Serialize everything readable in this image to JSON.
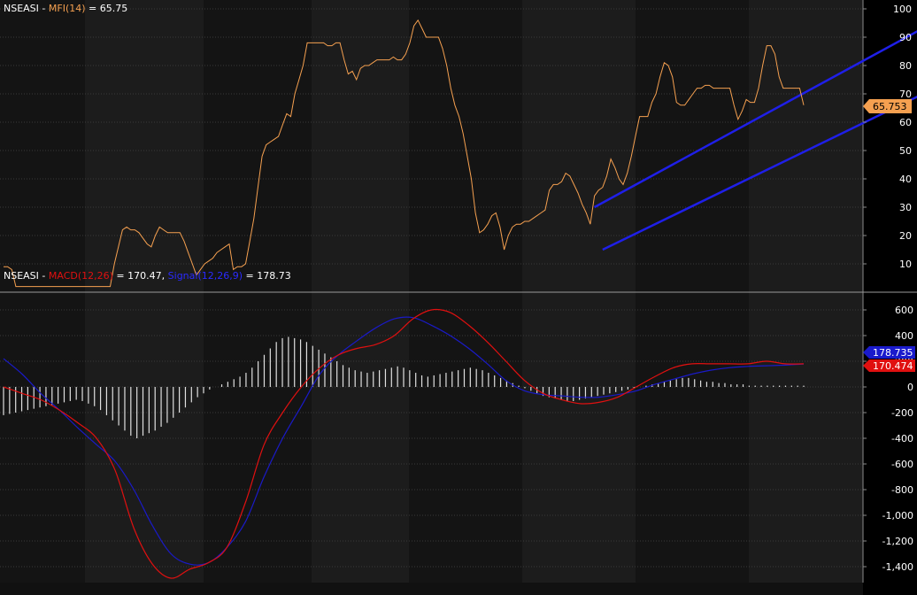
{
  "colors": {
    "background": "#000000",
    "band_dark": "#141414",
    "band_light": "#1c1c1c",
    "grid": "#3a3a3a",
    "divider": "#9a9a9a",
    "mfi": "#f5a050",
    "mfi_badge": "#f5a050",
    "channel": "#1f1fe8",
    "macd": "#e01010",
    "signal": "#1a1ac8",
    "histogram": "#e0e0e0",
    "text": "#ffffff"
  },
  "header_top": {
    "symbol": "NSEASI",
    "sep": " - ",
    "indicator": "MFI(14)",
    "eq": " = ",
    "value": "65.75"
  },
  "header_bottom": {
    "symbol": "NSEASI",
    "sep": " - ",
    "macd_name": "MACD(12,26)",
    "eq1": " = ",
    "macd_value": "170.47",
    "comma": ", ",
    "signal_name": "Signal(12,26,9)",
    "eq2": " = ",
    "signal_value": "178.73"
  },
  "badges": {
    "mfi_last": "65.753",
    "signal_last": "178.735",
    "macd_last": "170.474"
  },
  "chart_data": [
    {
      "type": "line",
      "title": "NSEASI - MFI(14) = 65.75",
      "ylim": [
        0,
        100
      ],
      "yticks": [
        "10",
        "20",
        "30",
        "40",
        "50",
        "60",
        "70",
        "80",
        "90",
        "100"
      ],
      "series": [
        {
          "name": "MFI(14)",
          "values": [
            9,
            9,
            8,
            2,
            2,
            2,
            2,
            2,
            2,
            2,
            2,
            2,
            2,
            2,
            2,
            2,
            2,
            2,
            2,
            2,
            2,
            2,
            2,
            2,
            2,
            2,
            2,
            10,
            16,
            22,
            23,
            22,
            22,
            21,
            19,
            17,
            16,
            20,
            23,
            22,
            21,
            21,
            21,
            21,
            18,
            14,
            10,
            6,
            8,
            10,
            11,
            12,
            14,
            15,
            16,
            17,
            8,
            9,
            9,
            10,
            18,
            26,
            37,
            48,
            52,
            53,
            54,
            55,
            59,
            63,
            62,
            70,
            75,
            80,
            88,
            88,
            88,
            88,
            88,
            87,
            87,
            88,
            88,
            82,
            77,
            78,
            75,
            79,
            80,
            80,
            81,
            82,
            82,
            82,
            82,
            83,
            82,
            82,
            84,
            88,
            94,
            96,
            93,
            90,
            90,
            90,
            90,
            86,
            80,
            72,
            66,
            62,
            56,
            48,
            40,
            28,
            21,
            22,
            24,
            27,
            28,
            23,
            15,
            20,
            23,
            24,
            24,
            25,
            25,
            26,
            27,
            28,
            29,
            36,
            38,
            38,
            39,
            42,
            41,
            38,
            35,
            31,
            28,
            24,
            34,
            36,
            37,
            41,
            47,
            44,
            40,
            38,
            42,
            48,
            55,
            62,
            62,
            62,
            67,
            70,
            76,
            81,
            80,
            76,
            67,
            66,
            66,
            68,
            70,
            72,
            72,
            73,
            73,
            72,
            72,
            72,
            72,
            72,
            66,
            61,
            64,
            68,
            67,
            67,
            72,
            80,
            87,
            87,
            84,
            76,
            72,
            72,
            72,
            72,
            72,
            66
          ]
        }
      ],
      "channel_lines": [
        {
          "name": "upper",
          "x": [
            144,
            234
          ],
          "y": [
            30,
            101
          ]
        },
        {
          "name": "lower",
          "x": [
            146,
            244
          ],
          "y": [
            15,
            84
          ]
        }
      ]
    },
    {
      "type": "line",
      "title": "NSEASI - MACD(12,26) = 170.47, Signal(12,26,9) = 178.73",
      "ylim": [
        -1520,
        770
      ],
      "yticks": [
        "600",
        "400",
        "200",
        "0",
        "-200",
        "-400",
        "-600",
        "-800",
        "-1,000",
        "-1,200",
        "-1,400"
      ],
      "series": [
        {
          "name": "MACD(12,26)",
          "values": [
            0,
            -50,
            -100,
            -180,
            -280,
            -400,
            -650,
            -1100,
            -1380,
            -1490,
            -1420,
            -1370,
            -1250,
            -900,
            -450,
            -200,
            0,
            150,
            250,
            300,
            330,
            400,
            530,
            600,
            580,
            480,
            350,
            200,
            50,
            -50,
            -100,
            -130,
            -120,
            -80,
            0,
            80,
            150,
            180,
            180,
            180,
            180,
            200,
            180,
            180
          ]
        },
        {
          "name": "Signal(12,26,9)",
          "values": [
            220,
            100,
            -50,
            -180,
            -320,
            -450,
            -580,
            -800,
            -1080,
            -1300,
            -1380,
            -1370,
            -1250,
            -1050,
            -700,
            -400,
            -150,
            100,
            250,
            360,
            460,
            530,
            540,
            480,
            400,
            300,
            180,
            50,
            -30,
            -60,
            -70,
            -80,
            -80,
            -60,
            -30,
            20,
            60,
            100,
            130,
            150,
            160,
            165,
            170,
            178
          ]
        }
      ],
      "histogram": [
        -220,
        -210,
        -200,
        -190,
        -180,
        -170,
        -160,
        -150,
        -140,
        -130,
        -120,
        -110,
        -100,
        -110,
        -130,
        -150,
        -180,
        -220,
        -260,
        -300,
        -340,
        -380,
        -400,
        -380,
        -360,
        -340,
        -310,
        -280,
        -240,
        -200,
        -160,
        -120,
        -80,
        -50,
        -20,
        0,
        20,
        40,
        60,
        80,
        110,
        150,
        200,
        250,
        300,
        350,
        380,
        390,
        380,
        370,
        350,
        320,
        290,
        260,
        230,
        200,
        170,
        150,
        130,
        120,
        110,
        120,
        130,
        140,
        150,
        160,
        150,
        130,
        110,
        90,
        80,
        90,
        100,
        110,
        120,
        130,
        140,
        150,
        140,
        130,
        110,
        90,
        70,
        50,
        30,
        10,
        -10,
        -30,
        -50,
        -70,
        -80,
        -90,
        -100,
        -110,
        -110,
        -100,
        -90,
        -80,
        -70,
        -60,
        -50,
        -40,
        -30,
        -20,
        -10,
        0,
        10,
        20,
        30,
        40,
        50,
        60,
        70,
        70,
        60,
        50,
        40,
        40,
        30,
        30,
        20,
        20,
        20,
        10,
        10,
        10,
        10,
        10,
        10,
        10,
        10,
        10,
        10
      ]
    }
  ]
}
